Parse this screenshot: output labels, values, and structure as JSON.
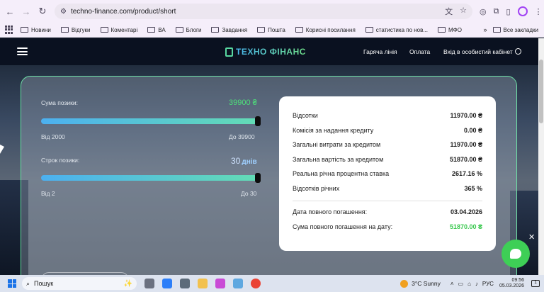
{
  "browser": {
    "url": "techno-finance.com/product/short",
    "bookmarks": [
      "Новини",
      "Відгуки",
      "Коментарі",
      "ВА",
      "Блоги",
      "Завдання",
      "Пошта",
      "Корисні посилання",
      "статистика по нов...",
      "МФО"
    ],
    "bookmarks_more": "»",
    "all_bookmarks": "Все закладки"
  },
  "header": {
    "logo": "ТЕХНО ФІНАНС",
    "nav": {
      "hotline": "Гаряча лінія",
      "payment": "Оплата",
      "login": "Вхід в особистий кабінет"
    }
  },
  "calculator": {
    "amount": {
      "label": "Сума позики:",
      "value": "39900 ₴",
      "min": "Від 2000",
      "max": "До 39900",
      "fraction": 1.0
    },
    "term": {
      "label": "Строк позики:",
      "value": "30",
      "unit": "днів",
      "min": "Від 2",
      "max": "До 30",
      "fraction": 1.0
    }
  },
  "summary": {
    "rows": [
      {
        "label": "Відсотки",
        "value": "11970.00 ₴"
      },
      {
        "label": "Комісія за надання кредиту",
        "value": "0.00 ₴"
      },
      {
        "label": "Загальні витрати за кредитом",
        "value": "11970.00 ₴"
      },
      {
        "label": "Загальна вартість за кредитом",
        "value": "51870.00 ₴"
      },
      {
        "label": "Реальна річна процентна ставка",
        "value": "2617.16 %"
      },
      {
        "label": "Відсотків річних",
        "value": "365 %"
      }
    ],
    "due_date": {
      "label": "Дата повного погашення:",
      "value": "03.04.2026"
    },
    "total_due": {
      "label": "Сума повного погашення на дату:",
      "value": "51870.00 ₴"
    }
  },
  "taskbar": {
    "search_placeholder": "Пошук",
    "weather_temp": "3°C",
    "weather_text": "Sunny",
    "lang": "РУС",
    "time": "09:56",
    "date": "05.03.2026",
    "notifications": "1"
  },
  "colors": {
    "accent_green": "#3ac84f",
    "slider_start": "#4cb0f0",
    "slider_end": "#63dcb5",
    "header_bg": "#0a1120"
  }
}
